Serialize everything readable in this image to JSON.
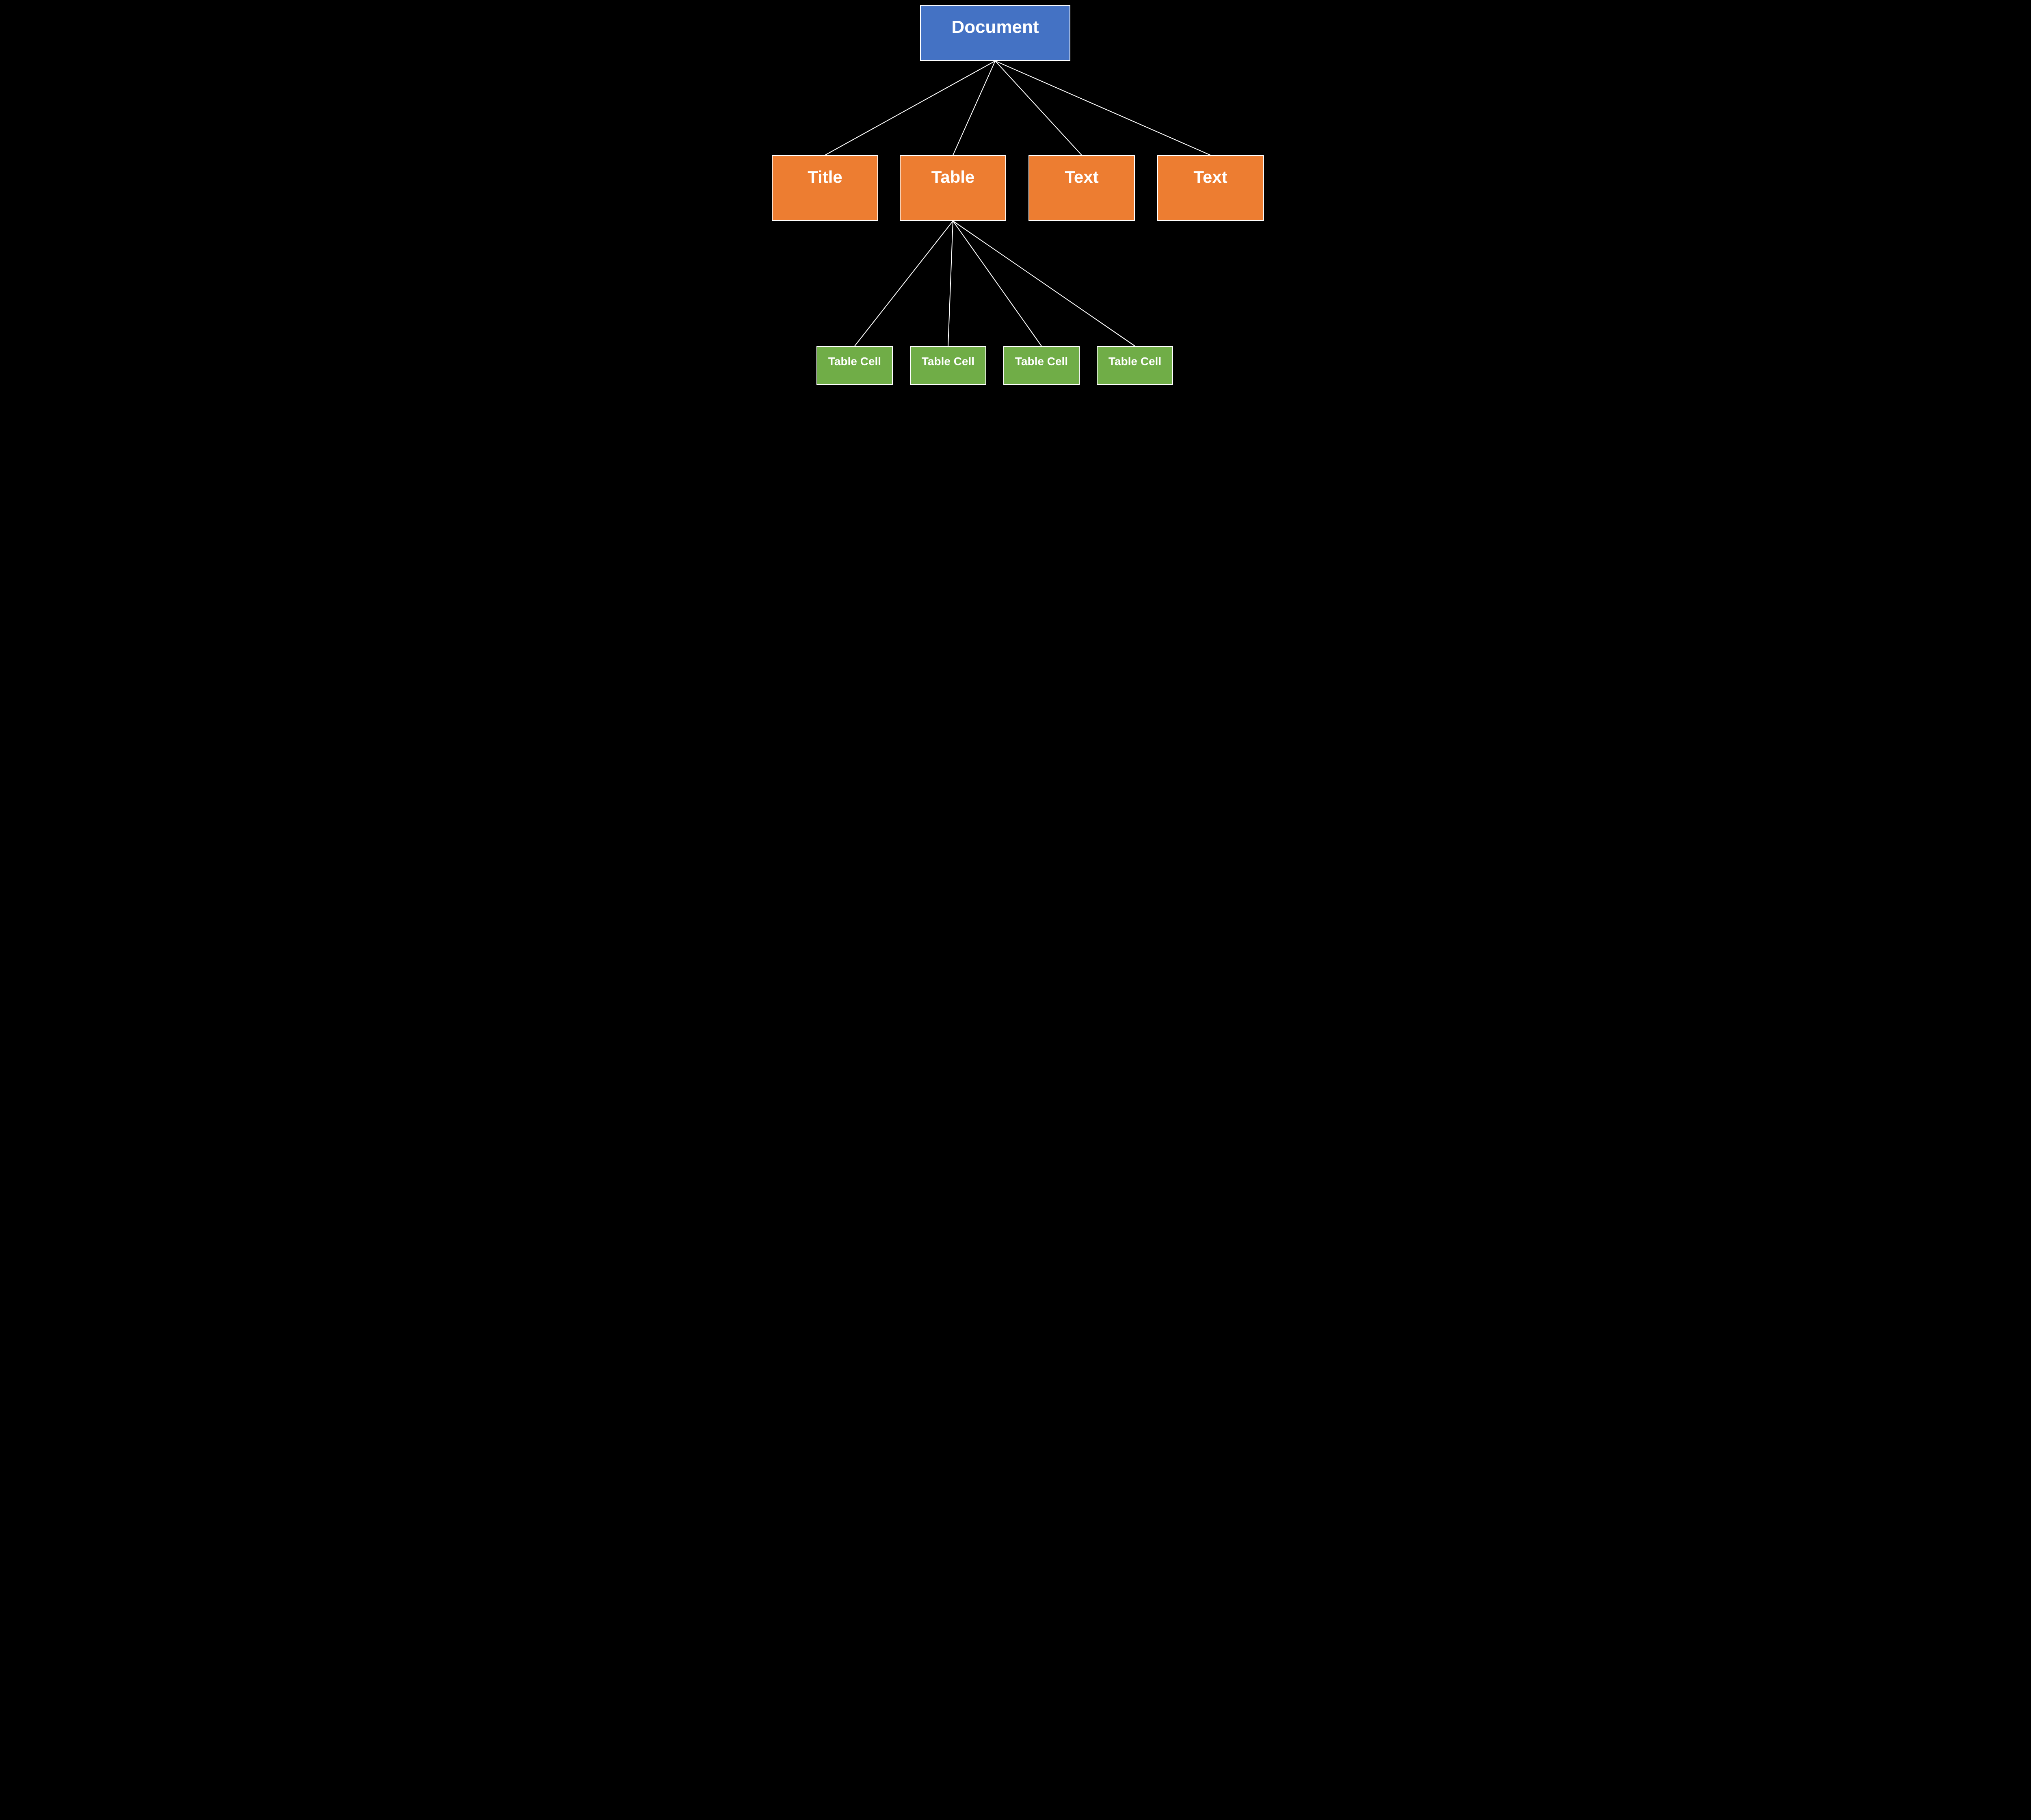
{
  "colors": {
    "root": "#4472C4",
    "level1": "#ED7D31",
    "leaf": "#70AD47",
    "border": "#FFFFFF",
    "line": "#FFFFFF",
    "bg": "#000000"
  },
  "nodes": {
    "root": {
      "label": "Document"
    },
    "title": {
      "label": "Title"
    },
    "table": {
      "label": "Table"
    },
    "text1": {
      "label": "Text"
    },
    "text2": {
      "label": "Text"
    },
    "cell1": {
      "label": "Table Cell"
    },
    "cell2": {
      "label": "Table Cell"
    },
    "cell3": {
      "label": "Table Cell"
    },
    "cell4": {
      "label": "Table Cell"
    }
  },
  "edges": [
    {
      "from": "root",
      "to": "title"
    },
    {
      "from": "root",
      "to": "table"
    },
    {
      "from": "root",
      "to": "text1"
    },
    {
      "from": "root",
      "to": "text2"
    },
    {
      "from": "table",
      "to": "cell1"
    },
    {
      "from": "table",
      "to": "cell2"
    },
    {
      "from": "table",
      "to": "cell3"
    },
    {
      "from": "table",
      "to": "cell4"
    }
  ]
}
